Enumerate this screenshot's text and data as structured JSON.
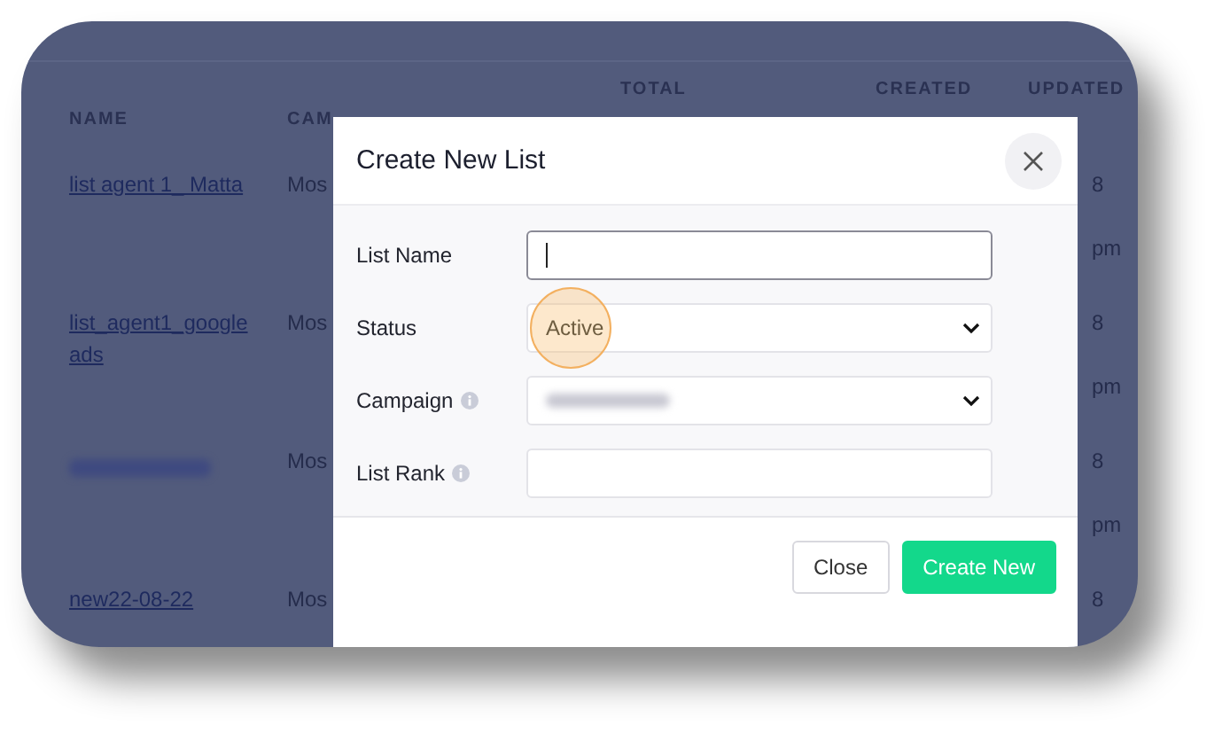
{
  "table": {
    "columns": [
      {
        "label": "NAME"
      },
      {
        "label": "CAM"
      },
      {
        "label": "TOTAL"
      },
      {
        "label": "CREATED"
      },
      {
        "label": "UPDATED"
      }
    ],
    "rows": [
      {
        "kind": "link",
        "name": "list agent 1_ Matta",
        "campaign": "Mos",
        "updated": [
          "8",
          "pm"
        ]
      },
      {
        "kind": "link",
        "name": "list_agent1_google ads",
        "campaign": "Mos",
        "updated": [
          "8",
          "pm"
        ]
      },
      {
        "kind": "redacted",
        "campaign": "Mos",
        "updated": [
          "8",
          "pm"
        ]
      },
      {
        "kind": "link",
        "name": "new22-08-22",
        "campaign": "Mos",
        "updated": [
          "8"
        ]
      }
    ]
  },
  "modal": {
    "title": "Create New List",
    "fields": [
      {
        "label": "List Name",
        "kind": "text",
        "info": false,
        "focused": true,
        "clicked": false
      },
      {
        "label": "Status",
        "kind": "select",
        "value": "Active",
        "info": false,
        "focused": false,
        "clicked": true
      },
      {
        "label": "Campaign",
        "kind": "select",
        "redacted": true,
        "info": true,
        "focused": false,
        "clicked": false
      },
      {
        "label": "List Rank",
        "kind": "text",
        "info": true,
        "focused": false,
        "clicked": false
      }
    ],
    "buttons": [
      {
        "label": "Close",
        "kind": "secondary"
      },
      {
        "label": "Create New",
        "kind": "primary"
      }
    ]
  }
}
